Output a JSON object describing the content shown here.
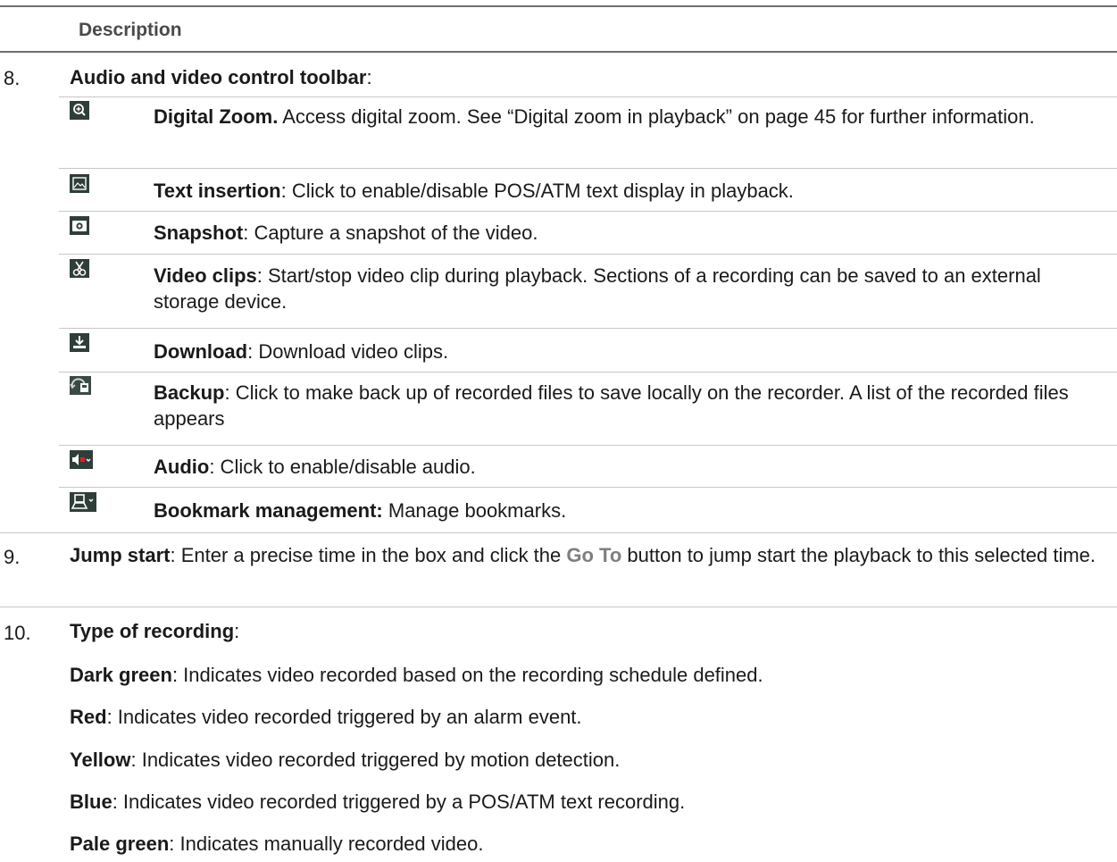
{
  "header": {
    "description": "Description"
  },
  "item8": {
    "number": "8.",
    "title": "Audio and video control toolbar",
    "colon": ":",
    "tools": [
      {
        "icon": "digital-zoom-icon",
        "name": "Digital Zoom.",
        "text": " Access digital zoom. See “Digital zoom in playback” on page 45 for further information."
      },
      {
        "icon": "text-insertion-icon",
        "name": "Text insertion",
        "text": ": Click to enable/disable POS/ATM text display in playback."
      },
      {
        "icon": "snapshot-icon",
        "name": "Snapshot",
        "text": ": Capture a snapshot of the video."
      },
      {
        "icon": "video-clips-icon",
        "name": "Video clips",
        "text": ": Start/stop video clip during playback. Sections of a recording can be saved to an external storage device."
      },
      {
        "icon": "download-icon",
        "name": "Download",
        "text": ": Download video clips."
      },
      {
        "icon": "backup-icon",
        "name": "Backup",
        "text": ": Click to make back up of recorded files to save locally on the recorder. A list of the recorded files appears"
      },
      {
        "icon": "audio-icon",
        "name": "Audio",
        "text": ": Click to enable/disable audio."
      },
      {
        "icon": "bookmark-icon",
        "name": "Bookmark management:",
        "text": " Manage bookmarks."
      }
    ]
  },
  "item9": {
    "number": "9.",
    "title": "Jump start",
    "text_before": ": Enter a precise time in the box and click the ",
    "goto": "Go To",
    "text_after": " button to jump start the playback to this selected time."
  },
  "item10": {
    "number": "10.",
    "title": "Type of recording",
    "colon": ":",
    "types": [
      {
        "name": "Dark green",
        "text": ": Indicates video recorded based on the recording schedule defined."
      },
      {
        "name": "Red",
        "text": ": Indicates video recorded triggered by an alarm event."
      },
      {
        "name": "Yellow",
        "text": ": Indicates video recorded triggered by motion detection."
      },
      {
        "name": "Blue",
        "text": ": Indicates video recorded triggered by a POS/ATM text recording."
      },
      {
        "name": "Pale green",
        "text": ": Indicates manually recorded video."
      }
    ]
  }
}
